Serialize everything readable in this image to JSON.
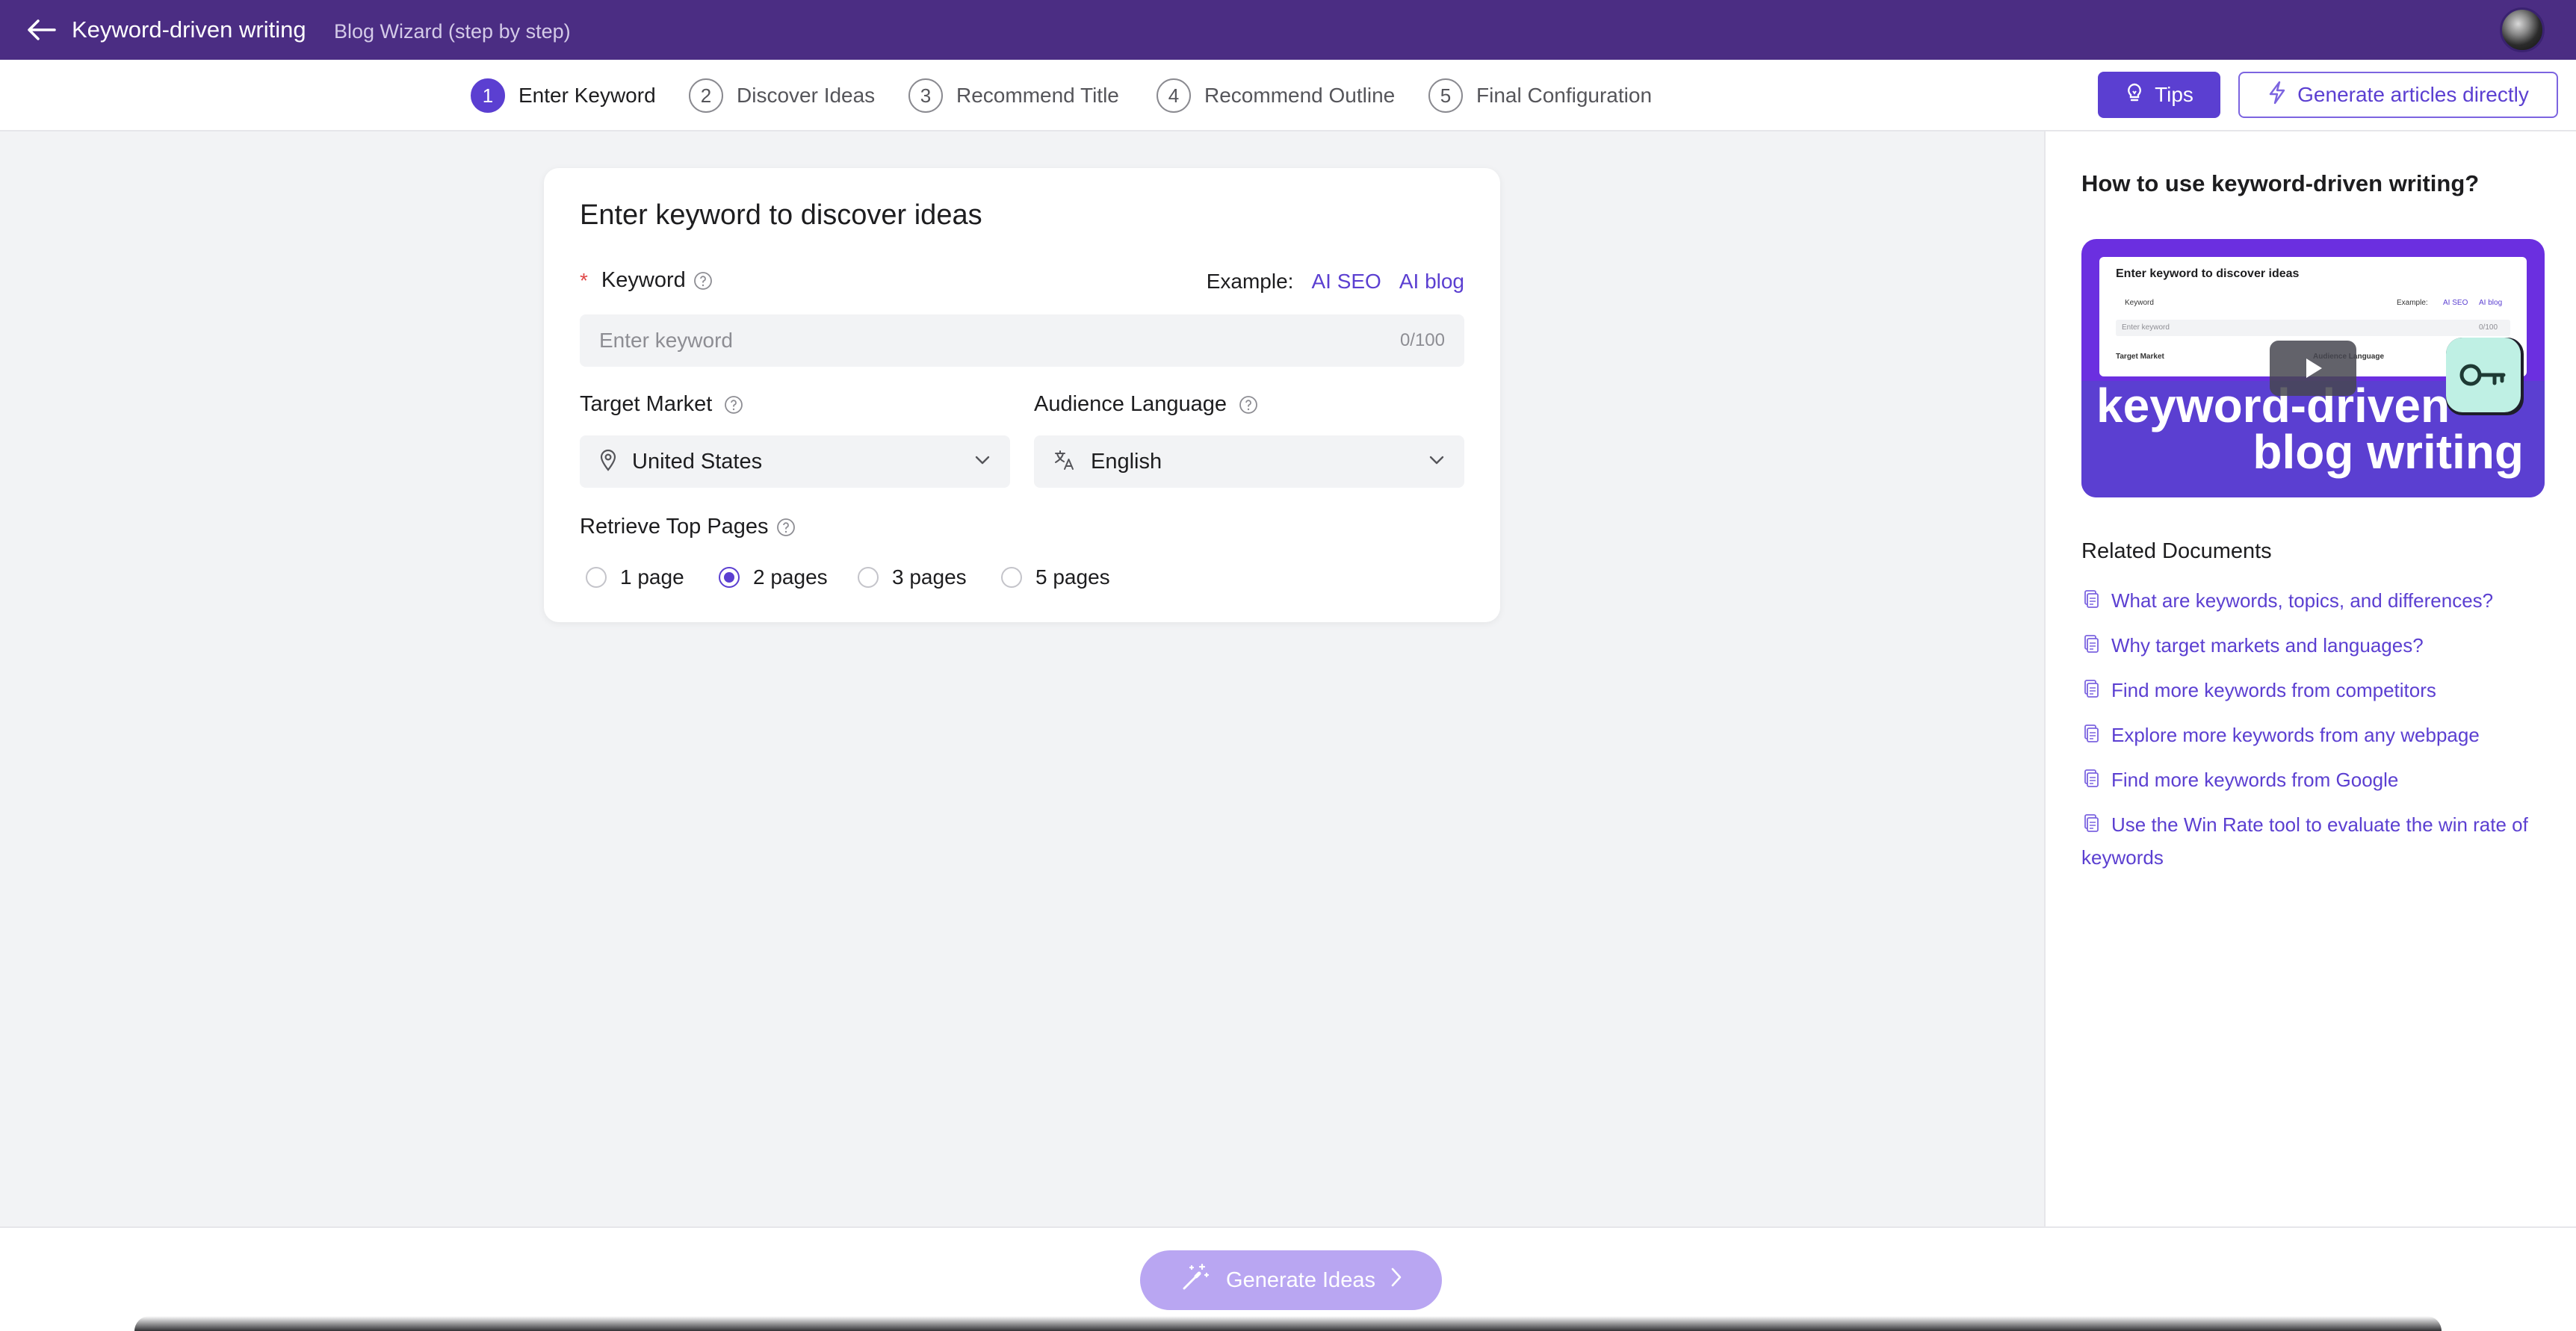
{
  "header": {
    "title": "Keyword-driven writing",
    "subtitle": "Blog Wizard (step by step)"
  },
  "steps": [
    {
      "num": "1",
      "label": "Enter Keyword",
      "active": true
    },
    {
      "num": "2",
      "label": "Discover Ideas",
      "active": false
    },
    {
      "num": "3",
      "label": "Recommend Title",
      "active": false
    },
    {
      "num": "4",
      "label": "Recommend Outline",
      "active": false
    },
    {
      "num": "5",
      "label": "Final Configuration",
      "active": false
    }
  ],
  "actions": {
    "tips_label": "Tips",
    "generate_direct_label": "Generate articles directly"
  },
  "form": {
    "title": "Enter keyword to discover ideas",
    "required_mark": "*",
    "keyword_label": "Keyword",
    "example_label": "Example:",
    "examples": [
      "AI SEO",
      "AI blog"
    ],
    "keyword_placeholder": "Enter keyword",
    "keyword_value": "",
    "keyword_counter": "0/100",
    "target_market_label": "Target Market",
    "target_market_value": "United States",
    "audience_language_label": "Audience Language",
    "audience_language_value": "English",
    "retrieve_label": "Retrieve Top Pages",
    "retrieve_options": [
      "1 page",
      "2 pages",
      "3 pages",
      "5 pages"
    ],
    "retrieve_selected": "2 pages"
  },
  "help_panel": {
    "title": "How to use keyword-driven writing?",
    "video": {
      "mock_title": "Enter keyword to discover ideas",
      "mock_keyword": "Keyword",
      "mock_example": "Example:",
      "mock_example_1": "AI SEO",
      "mock_example_2": "AI blog",
      "mock_placeholder": "Enter keyword",
      "mock_counter": "0/100",
      "mock_target": "Target Market",
      "mock_language": "Audience Language",
      "headline_1": "keyword-driven",
      "headline_2": "blog writing"
    },
    "related_title": "Related Documents",
    "documents": [
      "What are keywords, topics, and differences?",
      "Why target markets and languages?",
      "Find more keywords from competitors",
      "Explore more keywords from any webpage",
      "Find more keywords from Google",
      "Use the Win Rate tool to evaluate the win rate of keywords"
    ]
  },
  "footer": {
    "generate_ideas_label": "Generate Ideas"
  },
  "colors": {
    "brand_header": "#4b2d83",
    "accent": "#5b3fd1",
    "disabled_button": "#b9a6f2",
    "required": "#e04848"
  }
}
